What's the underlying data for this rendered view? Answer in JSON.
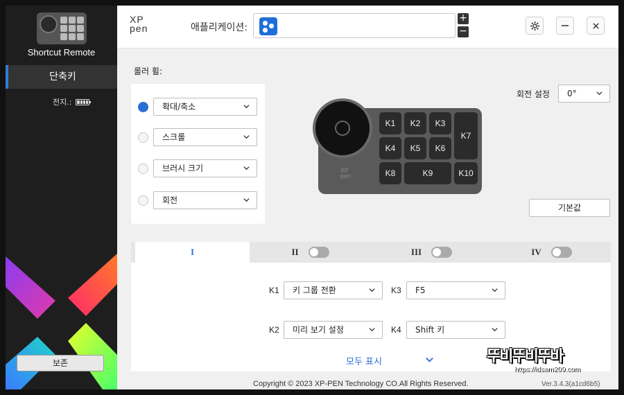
{
  "sidebar": {
    "device_name": "Shortcut Remote",
    "nav_label": "단축키",
    "battery_label": "전지.:",
    "save_label": "보존"
  },
  "header": {
    "logo_line1": "XP",
    "logo_line2": "pen",
    "app_label": "애플리케이션:",
    "plus": "+",
    "minus": "−"
  },
  "roller": {
    "title": "롤러 휠:",
    "options": [
      {
        "label": "확대/축소",
        "selected": true
      },
      {
        "label": "스크롤",
        "selected": false
      },
      {
        "label": "브러시 크기",
        "selected": false
      },
      {
        "label": "회전",
        "selected": false
      }
    ]
  },
  "device": {
    "brand_line1": "XP",
    "brand_line2": "pen",
    "keys": [
      "K1",
      "K2",
      "K3",
      "K7",
      "K4",
      "K5",
      "K6",
      "K8",
      "K9",
      "K10"
    ]
  },
  "rotation": {
    "label": "회전 설정",
    "value": "0°"
  },
  "default_label": "기본값",
  "tabs": [
    {
      "label": "I",
      "active": true
    },
    {
      "label": "II",
      "active": false
    },
    {
      "label": "III",
      "active": false
    },
    {
      "label": "IV",
      "active": false
    }
  ],
  "key_assignments": [
    {
      "key": "K1",
      "value": "키 그룹 전환"
    },
    {
      "key": "K3",
      "value": "F5"
    },
    {
      "key": "K2",
      "value": "미리 보기 설정"
    },
    {
      "key": "K4",
      "value": "Shift 키"
    }
  ],
  "show_all_label": "모두 표시",
  "footer": {
    "copyright": "Copyright © 2023  XP-PEN Technology CO.All Rights Reserved.",
    "version": "Ver.3.4.3(a1cd6b5)"
  },
  "watermark": {
    "text": "뚜비뚜비뚜바",
    "url": "https://idsam209.com"
  },
  "colors": {
    "accent": "#2b6fd6",
    "sidebar_bg": "#1e1e1e"
  }
}
